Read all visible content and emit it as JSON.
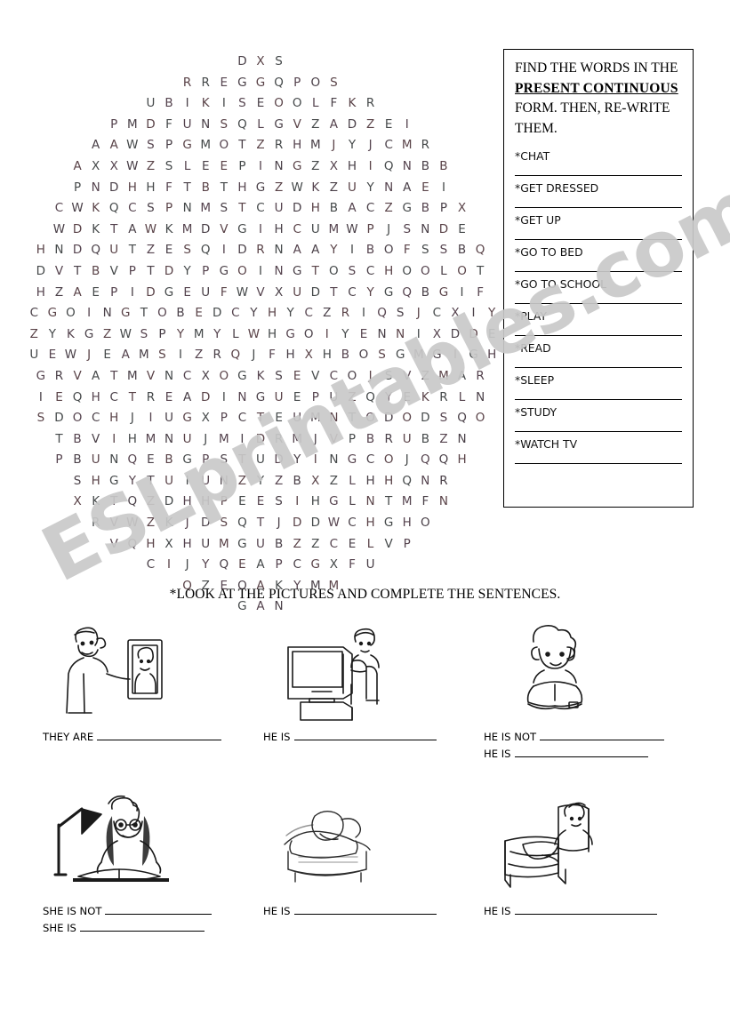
{
  "wordsearch": {
    "rows": [
      "DXS",
      "RREGGQPOS",
      "UBIKISEOOLFKR",
      "PMDFUNSQLGVZADZEI",
      "AAWSPGMOTZRHMJYJCMR",
      "AXXWZSLEEPINGZXHIQNBB",
      "PNDHHFTBTHGZWKZUYNAEI",
      "CWKQCSPNMSTCUDHBACZGBPX",
      "WDKTAWKMDVGIHCUMWPJSNDE",
      "HNDQUTZESQIDRNAAYIBOFSSBQ",
      "DVTBVPTDYPGOINGTOSCHOOLOT",
      "HZAEPIDGEUFWVXUDTCYGQBGIF",
      "CGOINGTOBEDCYHYCZRIQSJCXIYA",
      "ZYKGZWSPYMYLWHGOIYENNIXDDET",
      "UEWJEAMSIZRQJFHXHBOSGMGIGHL",
      "GRVATMVNCXOGKSEVCOJSVZMAR",
      "IEQHCTREADINGUEPUZQYEKRLN",
      "SDOCHJIUGXPCTEUMNTODODSQO",
      "TBVIHMNUJMIDRMJVPBRUBZN",
      "PBUNQEBGPSTUDYINGCOJQQH",
      "SHGYTUIUNZYZBXZLHHQNR",
      "XKTQZDHHPEESIHGLNTMFN",
      "RVWZKJDSQTJDDWCHGHO",
      "VQHXHUMGUBZZCELVP",
      "CIJYQEAPCGXFU",
      "QZEOAKYMM",
      "GAN"
    ]
  },
  "wordbox": {
    "intro_part1": "FIND THE WORDS IN THE ",
    "intro_emphasis": "PRESENT CONTINUOUS",
    "intro_part2": " FORM. THEN, RE-WRITE THEM.",
    "words": [
      "*CHAT",
      "*GET DRESSED",
      "*GET UP",
      "*GO TO BED",
      "*GO TO SCHOOL",
      "*PLAY",
      "*READ",
      "*SLEEP",
      "*STUDY",
      "*WATCH TV"
    ]
  },
  "section2": {
    "title": "*LOOK AT THE PICTURES AND COMPLETE THE SENTENCES.",
    "pictures": [
      {
        "icon": "man-showing-photo-icon",
        "prompts": [
          {
            "label": "THEY ARE",
            "blank": "w140"
          }
        ]
      },
      {
        "icon": "person-watching-tv-icon",
        "prompts": [
          {
            "label": "HE IS",
            "blank": "w160"
          }
        ]
      },
      {
        "icon": "boy-reading-book-icon",
        "prompts": [
          {
            "label": "HE IS NOT",
            "blank": "w140"
          },
          {
            "label": "HE IS",
            "blank": "w150"
          }
        ]
      },
      {
        "icon": "girl-studying-at-desk-icon",
        "prompts": [
          {
            "label": "SHE IS NOT",
            "blank": "w120"
          },
          {
            "label": "SHE IS",
            "blank": "w140"
          }
        ]
      },
      {
        "icon": "person-sleeping-icon",
        "prompts": [
          {
            "label": "HE IS",
            "blank": "w160"
          }
        ]
      },
      {
        "icon": "person-getting-up-from-bed-icon",
        "prompts": [
          {
            "label": "HE IS",
            "blank": "w160"
          }
        ]
      }
    ]
  },
  "watermark": {
    "text": "ESLprintables.com"
  },
  "colors": {
    "ink": "#000000",
    "letter_ink": "#4a4048",
    "watermark": "#c9c9c9"
  }
}
